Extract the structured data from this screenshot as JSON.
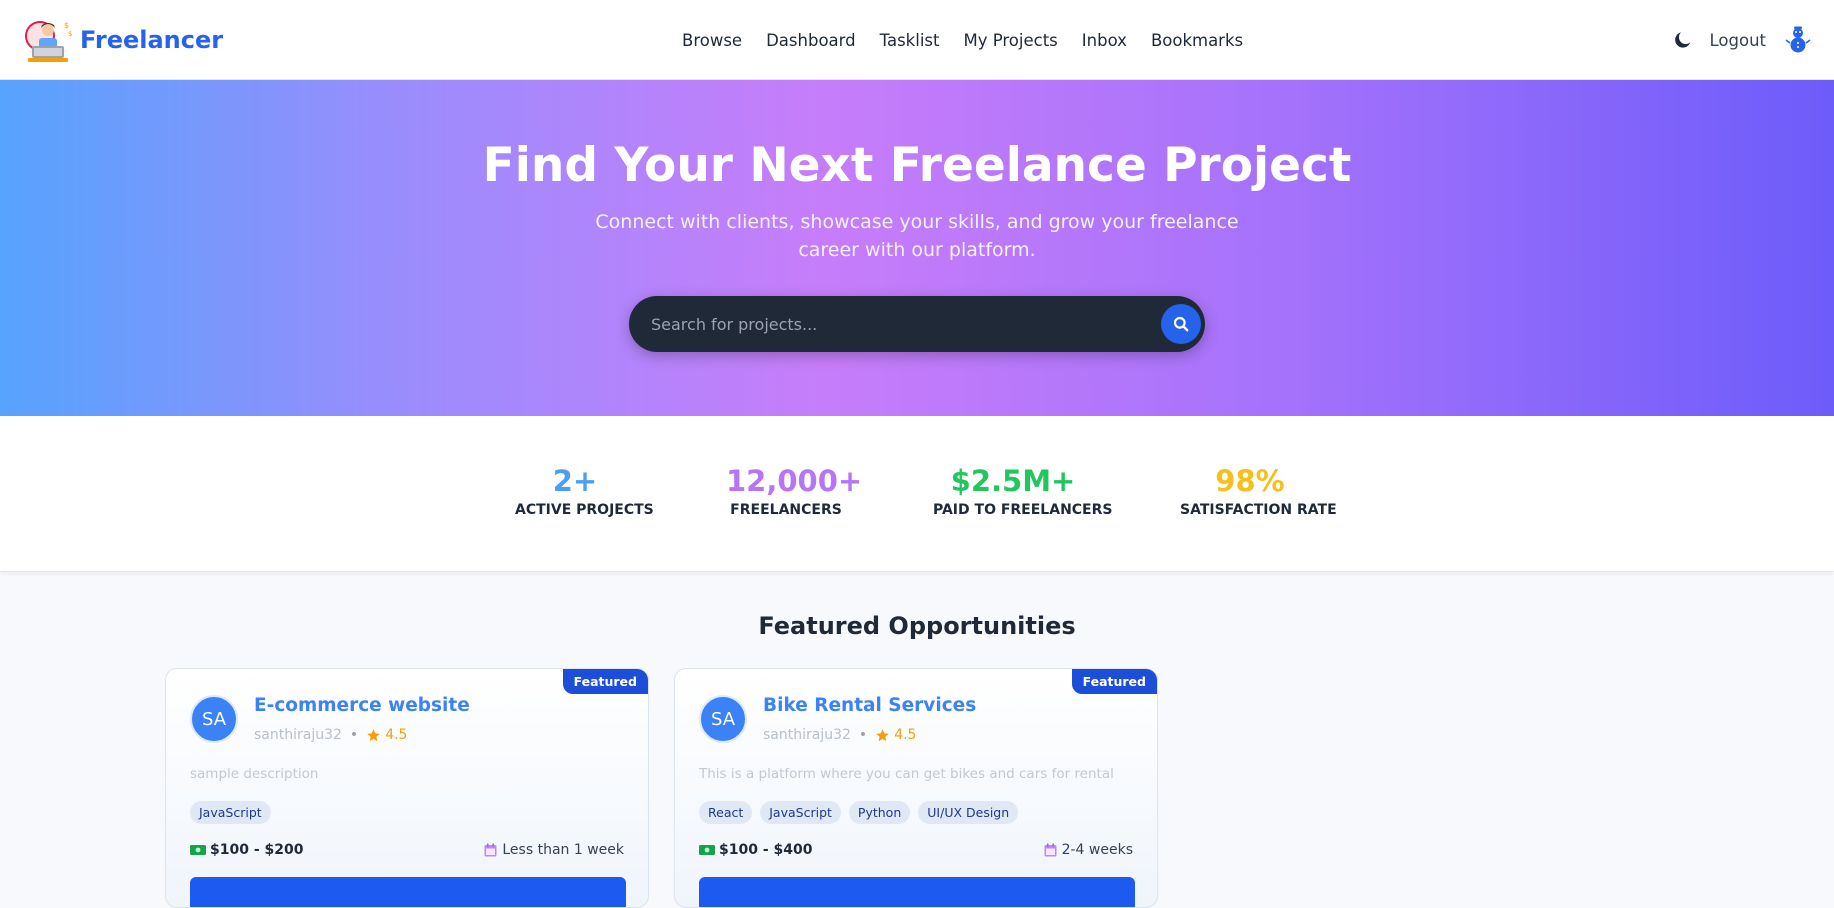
{
  "brand": {
    "name": "Freelancer"
  },
  "nav": {
    "links": [
      "Browse",
      "Dashboard",
      "Tasklist",
      "My Projects",
      "Inbox",
      "Bookmarks"
    ],
    "logout_label": "Logout"
  },
  "hero": {
    "title": "Find Your Next Freelance Project",
    "subtitle": "Connect with clients, showcase your skills, and grow your freelance career with our platform.",
    "search_placeholder": "Search for projects..."
  },
  "stats": [
    {
      "value": "2+",
      "label": "ACTIVE PROJECTS",
      "color": "#4a9ff5"
    },
    {
      "value": "12,000+",
      "label": "FREELANCERS",
      "color": "#b675f5"
    },
    {
      "value": "$2.5M+",
      "label": "PAID TO FREELANCERS",
      "color": "#22c55e"
    },
    {
      "value": "98%",
      "label": "SATISFACTION RATE",
      "color": "#f4c01e"
    }
  ],
  "featured": {
    "title": "Featured Opportunities",
    "cards": [
      {
        "badge": "Featured",
        "avatar_initials": "SA",
        "title": "E-commerce website",
        "user": "santhiraju32",
        "rating": "4.5",
        "description": "sample description",
        "tags": [
          "JavaScript"
        ],
        "budget": "$100 - $200",
        "duration": "Less than 1 week"
      },
      {
        "badge": "Featured",
        "avatar_initials": "SA",
        "title": "Bike Rental Services",
        "user": "santhiraju32",
        "rating": "4.5",
        "description": "This is a platform where you can get bikes and cars for rental",
        "tags": [
          "React",
          "JavaScript",
          "Python",
          "UI/UX Design"
        ],
        "budget": "$100 - $400",
        "duration": "2-4 weeks"
      }
    ]
  },
  "icons": {
    "logo": "freelancer-logo",
    "theme_toggle": "moon-icon",
    "user_avatar": "snowman-avatar-icon",
    "search": "search-icon",
    "rating": "star-icon",
    "budget": "money-icon",
    "duration": "calendar-icon"
  },
  "colors": {
    "brand": "#2563eb",
    "hero_gradient_start": "#56a3fd",
    "hero_gradient_mid": "#c77dfa",
    "hero_gradient_end": "#6d5cfa",
    "featured_badge": "#1d4ed8",
    "apply_button": "#1d5bf0"
  }
}
